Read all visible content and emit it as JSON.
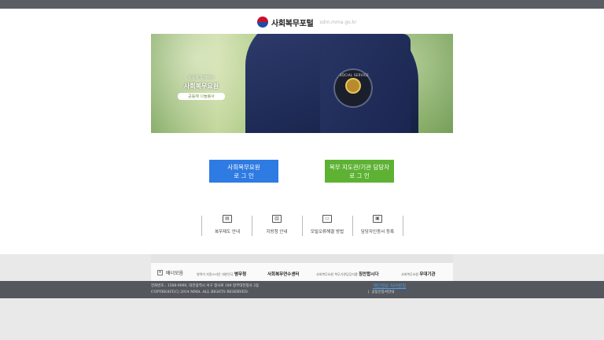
{
  "header": {
    "logo_text": "사회복무포털",
    "logo_url": "sdm.mma.go.kr"
  },
  "hero": {
    "slogan_line1": "이웃과 함께하는",
    "slogan_line2": "사회복무요원",
    "slogan_line3": "공동체 나눔봉사",
    "patch_text": "SOCIAL SERVICE",
    "patch_bottom": "사회복무"
  },
  "buttons": {
    "agent_login": {
      "line1": "사회복무요원",
      "line2": "로 그 인",
      "color": "#2e7be3"
    },
    "manager_login": {
      "line1": "복무 지도관/기관 담당자",
      "line2": "로 그 인",
      "color": "#5eb233"
    }
  },
  "quick_links": [
    {
      "label": "복무제도 안내",
      "icon": "document-icon"
    },
    {
      "label": "지방청 안내",
      "icon": "building-icon"
    },
    {
      "label": "모빌오류해결 방법",
      "icon": "monitor-icon"
    },
    {
      "label": "담당자인증서 등록",
      "icon": "id-card-icon"
    }
  ],
  "banner": {
    "title": "배너모음",
    "links": [
      {
        "small": "병역이 자랑스러운 대한민국",
        "strong": "병무청"
      },
      {
        "small": "",
        "strong": "사회복무연수센터"
      },
      {
        "small": "사회복무요원 복무기관담당자를",
        "strong": "칭찬합시다"
      },
      {
        "small": "사회복무요원",
        "strong": "우대기관"
      }
    ]
  },
  "footer": {
    "line1": "전화번호 : 1588-9090, 대전광역시 서구 청사로 189 정부대전청사 2동",
    "line2": "COPYRIGHT(C) 2014 MMA. ALL RIGHTS RESERVED.",
    "privacy_link": "개인정보 처리방침",
    "cert_link": "공동인증서안내"
  }
}
